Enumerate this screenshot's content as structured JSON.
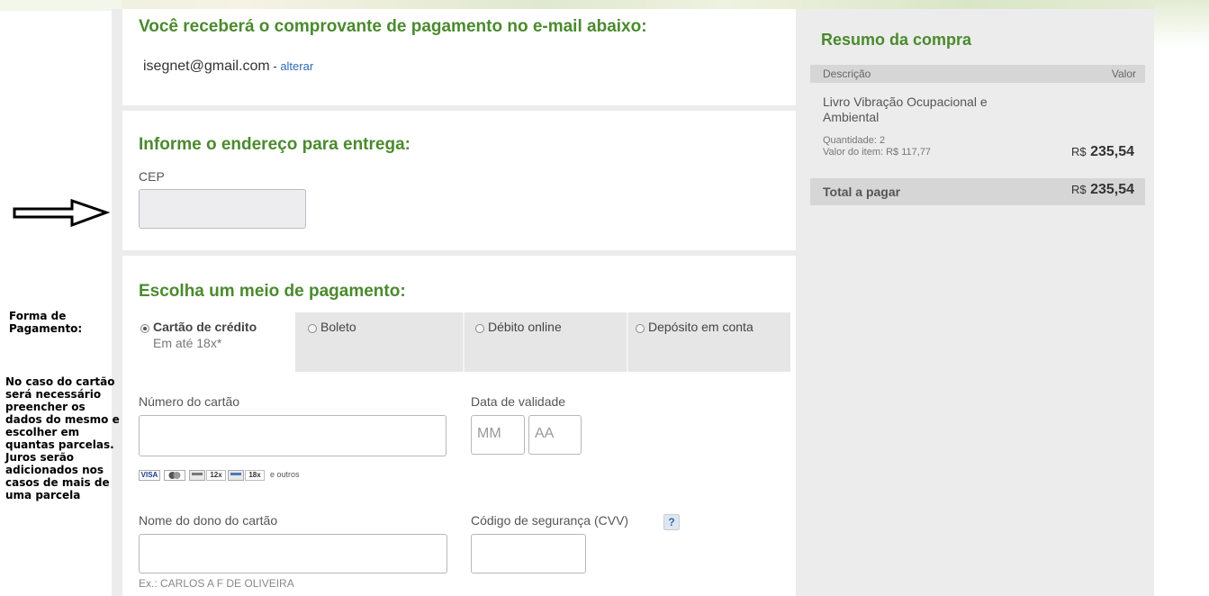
{
  "email_section": {
    "title": "Você receberá o comprovante de pagamento no e-mail abaixo:",
    "email": "isegnet@gmail.com",
    "separator": " - ",
    "change_link": "alterar"
  },
  "address_section": {
    "title": "Informe o endereço para entrega:",
    "cep_label": "CEP",
    "cep_value": ""
  },
  "payment_section": {
    "title": "Escolha um meio de pagamento:",
    "tabs": [
      {
        "label": "Cartão de crédito",
        "sublabel": "Em até 18x*",
        "selected": true
      },
      {
        "label": "Boleto",
        "selected": false
      },
      {
        "label": "Débito online",
        "selected": false
      },
      {
        "label": "Depósito em conta",
        "selected": false
      }
    ],
    "card_number_label": "Número do cartão",
    "expiry_label": "Data de validade",
    "expiry_month_placeholder": "MM",
    "expiry_year_placeholder": "AA",
    "card_brands": {
      "visa": "VISA",
      "installments_1": "12x",
      "installments_2": "18x",
      "others": "e outros"
    },
    "holder_label": "Nome do dono do cartão",
    "holder_hint": "Ex.: CARLOS A F DE OLIVEIRA",
    "cvv_label": "Código de segurança (CVV)",
    "cvv_help": "?"
  },
  "annotations": {
    "payment_form": [
      "Forma de",
      "Pagamento:"
    ],
    "card_note": [
      "No caso do cartão",
      "será necessário",
      "preencher os",
      "dados do mesmo e",
      "escolher em",
      "quantas parcelas.",
      "Juros serão",
      "adicionados nos",
      "casos de mais de",
      "uma parcela"
    ]
  },
  "summary": {
    "title": "Resumo da compra",
    "col_description": "Descrição",
    "col_value": "Valor",
    "item_name_line1": "Livro Vibração Ocupacional e",
    "item_name_line2": "Ambiental",
    "quantity": "Quantidade: 2",
    "unit_value": "Valor do item: R$ 117,77",
    "currency": "R$",
    "item_total": "235,54",
    "total_label": "Total a pagar",
    "total_value": "235,54"
  },
  "colors": {
    "heading_green": "#4b8a2e",
    "link_blue": "#2e6ab5",
    "panel_gray": "#ececec"
  }
}
